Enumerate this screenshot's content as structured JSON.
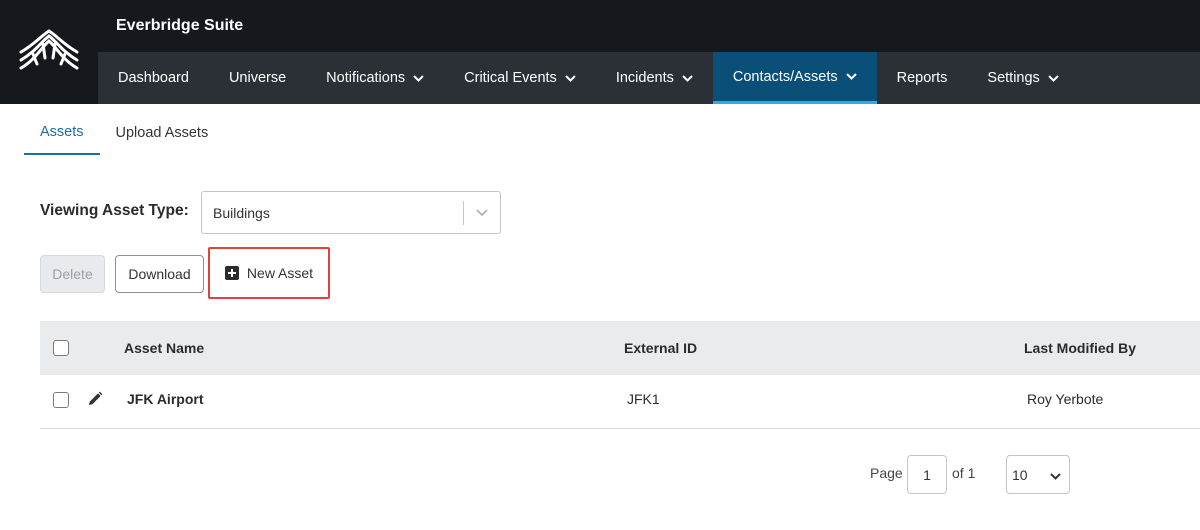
{
  "app": {
    "title": "Everbridge Suite"
  },
  "nav": {
    "items": [
      {
        "label": "Dashboard",
        "dropdown": false,
        "active": false
      },
      {
        "label": "Universe",
        "dropdown": false,
        "active": false
      },
      {
        "label": "Notifications",
        "dropdown": true,
        "active": false
      },
      {
        "label": "Critical Events",
        "dropdown": true,
        "active": false
      },
      {
        "label": "Incidents",
        "dropdown": true,
        "active": false
      },
      {
        "label": "Contacts/Assets",
        "dropdown": true,
        "active": true
      },
      {
        "label": "Reports",
        "dropdown": false,
        "active": false
      },
      {
        "label": "Settings",
        "dropdown": true,
        "active": false
      }
    ]
  },
  "subtabs": [
    {
      "label": "Assets",
      "active": true
    },
    {
      "label": "Upload Assets",
      "active": false
    }
  ],
  "asset_type": {
    "label": "Viewing Asset Type:",
    "value": "Buildings"
  },
  "toolbar": {
    "delete": "Delete",
    "download": "Download",
    "new_asset": "New Asset"
  },
  "table": {
    "headers": {
      "name": "Asset Name",
      "external_id": "External ID",
      "modified_by": "Last Modified By"
    },
    "rows": [
      {
        "name": "JFK Airport",
        "external_id": "JFK1",
        "modified_by": "Roy Yerbote"
      }
    ]
  },
  "pagination": {
    "page_label": "Page",
    "page": "1",
    "of_label": "of 1",
    "page_size": "10"
  },
  "colors": {
    "header_bg": "#15191e",
    "nav_bg": "#2b3036",
    "active_nav": "#0a4f78",
    "accent": "#1a6fa1",
    "highlight": "#e0413b"
  }
}
